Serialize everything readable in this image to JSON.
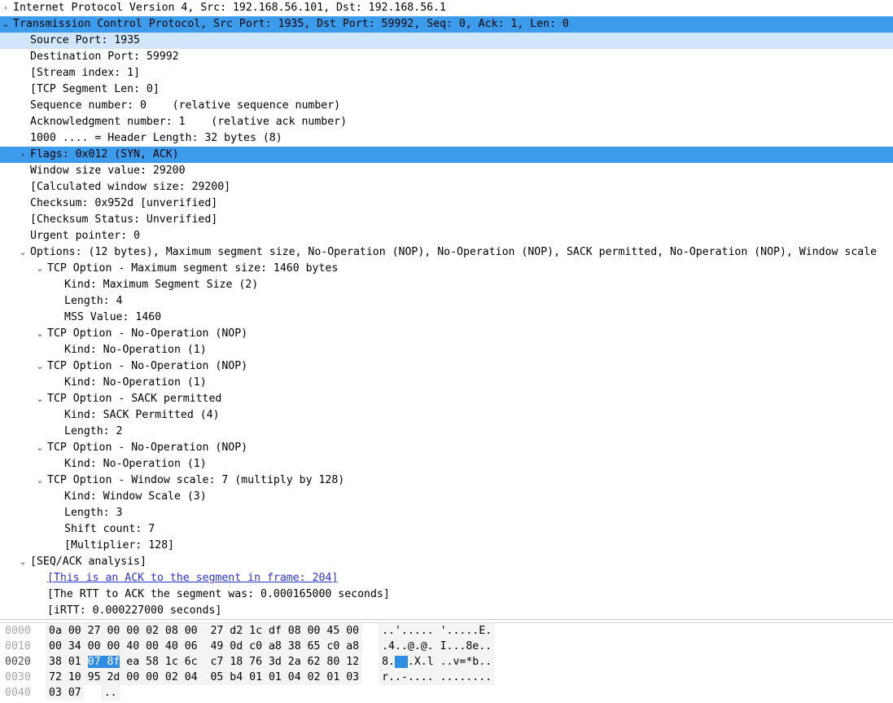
{
  "icons": {
    "expanded": "⌄",
    "collapsed": "›"
  },
  "detail_tree": {
    "rows": [
      {
        "indent": 0,
        "twisty": "collapsed",
        "select": "none",
        "text": "Internet Protocol Version 4, Src: 192.168.56.101, Dst: 192.168.56.1"
      },
      {
        "indent": 0,
        "twisty": "expanded",
        "select": "strong",
        "text": "Transmission Control Protocol, Src Port: 1935, Dst Port: 59992, Seq: 0, Ack: 1, Len: 0"
      },
      {
        "indent": 2,
        "twisty": "none",
        "select": "soft",
        "text": "Source Port: 1935"
      },
      {
        "indent": 2,
        "twisty": "none",
        "select": "none",
        "text": "Destination Port: 59992"
      },
      {
        "indent": 2,
        "twisty": "none",
        "select": "none",
        "text": "[Stream index: 1]"
      },
      {
        "indent": 2,
        "twisty": "none",
        "select": "none",
        "text": "[TCP Segment Len: 0]"
      },
      {
        "indent": 2,
        "twisty": "none",
        "select": "none",
        "text": "Sequence number: 0    (relative sequence number)"
      },
      {
        "indent": 2,
        "twisty": "none",
        "select": "none",
        "text": "Acknowledgment number: 1    (relative ack number)"
      },
      {
        "indent": 2,
        "twisty": "none",
        "select": "none",
        "text": "1000 .... = Header Length: 32 bytes (8)"
      },
      {
        "indent": 2,
        "twisty": "collapsed",
        "select": "strong",
        "text": "Flags: 0x012 (SYN, ACK)"
      },
      {
        "indent": 2,
        "twisty": "none",
        "select": "none",
        "text": "Window size value: 29200"
      },
      {
        "indent": 2,
        "twisty": "none",
        "select": "none",
        "text": "[Calculated window size: 29200]"
      },
      {
        "indent": 2,
        "twisty": "none",
        "select": "none",
        "text": "Checksum: 0x952d [unverified]"
      },
      {
        "indent": 2,
        "twisty": "none",
        "select": "none",
        "text": "[Checksum Status: Unverified]"
      },
      {
        "indent": 2,
        "twisty": "none",
        "select": "none",
        "text": "Urgent pointer: 0"
      },
      {
        "indent": 2,
        "twisty": "expanded",
        "select": "none",
        "text": "Options: (12 bytes), Maximum segment size, No-Operation (NOP), No-Operation (NOP), SACK permitted, No-Operation (NOP), Window scale"
      },
      {
        "indent": 4,
        "twisty": "expanded",
        "select": "none",
        "text": "TCP Option - Maximum segment size: 1460 bytes"
      },
      {
        "indent": 6,
        "twisty": "none",
        "select": "none",
        "text": "Kind: Maximum Segment Size (2)"
      },
      {
        "indent": 6,
        "twisty": "none",
        "select": "none",
        "text": "Length: 4"
      },
      {
        "indent": 6,
        "twisty": "none",
        "select": "none",
        "text": "MSS Value: 1460"
      },
      {
        "indent": 4,
        "twisty": "expanded",
        "select": "none",
        "text": "TCP Option - No-Operation (NOP)"
      },
      {
        "indent": 6,
        "twisty": "none",
        "select": "none",
        "text": "Kind: No-Operation (1)"
      },
      {
        "indent": 4,
        "twisty": "expanded",
        "select": "none",
        "text": "TCP Option - No-Operation (NOP)"
      },
      {
        "indent": 6,
        "twisty": "none",
        "select": "none",
        "text": "Kind: No-Operation (1)"
      },
      {
        "indent": 4,
        "twisty": "expanded",
        "select": "none",
        "text": "TCP Option - SACK permitted"
      },
      {
        "indent": 6,
        "twisty": "none",
        "select": "none",
        "text": "Kind: SACK Permitted (4)"
      },
      {
        "indent": 6,
        "twisty": "none",
        "select": "none",
        "text": "Length: 2"
      },
      {
        "indent": 4,
        "twisty": "expanded",
        "select": "none",
        "text": "TCP Option - No-Operation (NOP)"
      },
      {
        "indent": 6,
        "twisty": "none",
        "select": "none",
        "text": "Kind: No-Operation (1)"
      },
      {
        "indent": 4,
        "twisty": "expanded",
        "select": "none",
        "text": "TCP Option - Window scale: 7 (multiply by 128)"
      },
      {
        "indent": 6,
        "twisty": "none",
        "select": "none",
        "text": "Kind: Window Scale (3)"
      },
      {
        "indent": 6,
        "twisty": "none",
        "select": "none",
        "text": "Length: 3"
      },
      {
        "indent": 6,
        "twisty": "none",
        "select": "none",
        "text": "Shift count: 7"
      },
      {
        "indent": 6,
        "twisty": "none",
        "select": "none",
        "text": "[Multiplier: 128]"
      },
      {
        "indent": 2,
        "twisty": "expanded",
        "select": "none",
        "text": "[SEQ/ACK analysis]"
      },
      {
        "indent": 4,
        "twisty": "none",
        "select": "none",
        "link": true,
        "text": "[This is an ACK to the segment in frame: 204]"
      },
      {
        "indent": 4,
        "twisty": "none",
        "select": "none",
        "text": "[The RTT to ACK the segment was: 0.000165000 seconds]"
      },
      {
        "indent": 4,
        "twisty": "none",
        "select": "none",
        "text": "[iRTT: 0.000227000 seconds]"
      }
    ]
  },
  "hex_pane": {
    "rows": [
      {
        "offset": "0000",
        "current": false,
        "bytes": "0a 00 27 00 00 02 08 00  27 d2 1c df 08 00 45 00",
        "ascii": "..'..... '.....E."
      },
      {
        "offset": "0010",
        "current": false,
        "bytes": "00 34 00 00 40 00 40 06  49 0d c0 a8 38 65 c0 a8",
        "ascii": ".4..@.@. I...8e.."
      },
      {
        "offset": "0020",
        "current": true,
        "bytes_pre": "38 01 ",
        "bytes_hl": "07 8f",
        "bytes_post": " ea 58 1c 6c  c7 18 76 3d 2a 62 80 12",
        "ascii_pre": "8.",
        "ascii_hl": "..",
        "ascii_post": ".X.l ..v=*b.."
      },
      {
        "offset": "0030",
        "current": false,
        "bytes": "72 10 95 2d 00 00 02 04  05 b4 01 01 04 02 01 03",
        "ascii": "r..-.... ........"
      },
      {
        "offset": "0040",
        "current": false,
        "bytes": "03 07",
        "ascii": ".."
      }
    ]
  },
  "colors": {
    "selection_strong": "#3d9bec",
    "selection_soft": "#cfe6fb",
    "link": "#2a32d6",
    "hex_highlight": "#2f8de4",
    "hex_background": "#f4f4f4",
    "offset_text": "#a6a6a6"
  }
}
